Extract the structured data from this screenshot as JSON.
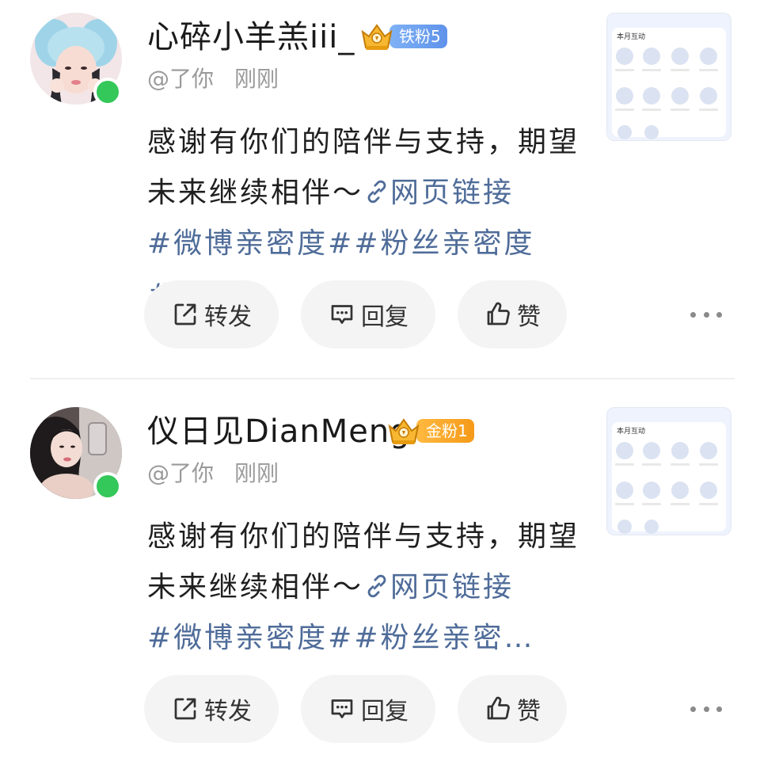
{
  "posts": [
    {
      "username": "心碎小羊羔iii_",
      "fan_badge": {
        "label": "铁粉5",
        "level": "iron",
        "color": "#5f92ea"
      },
      "meta": {
        "source": "@了你",
        "time": "刚刚"
      },
      "content": {
        "text": "感谢有你们的陪伴与支持，期望未来继续相伴～",
        "link_icon": "link-icon",
        "link_text": "网页链接",
        "tags": "#微博亲密度##粉丝亲密度#",
        "ellipsis": "…"
      },
      "thumbnail": {
        "title": "本月互动"
      },
      "actions": {
        "repost": "转发",
        "reply": "回复",
        "like": "赞"
      },
      "online": true
    },
    {
      "username": "仪日见DianMeng",
      "fan_badge": {
        "label": "金粉1",
        "level": "gold",
        "color": "#f59a18"
      },
      "meta": {
        "source": "@了你",
        "time": "刚刚"
      },
      "content": {
        "text": "感谢有你们的陪伴与支持，期望未来继续相伴～",
        "link_icon": "link-icon",
        "link_text": "网页链接",
        "tags": "#微博亲密度##粉丝亲密",
        "ellipsis": "…"
      },
      "thumbnail": {
        "title": "本月互动"
      },
      "actions": {
        "repost": "转发",
        "reply": "回复",
        "like": "赞"
      },
      "online": true
    }
  ],
  "colors": {
    "link": "#4f6c99",
    "online": "#34c759",
    "action_bg": "#f4f4f4",
    "meta": "#9a9a9a"
  }
}
